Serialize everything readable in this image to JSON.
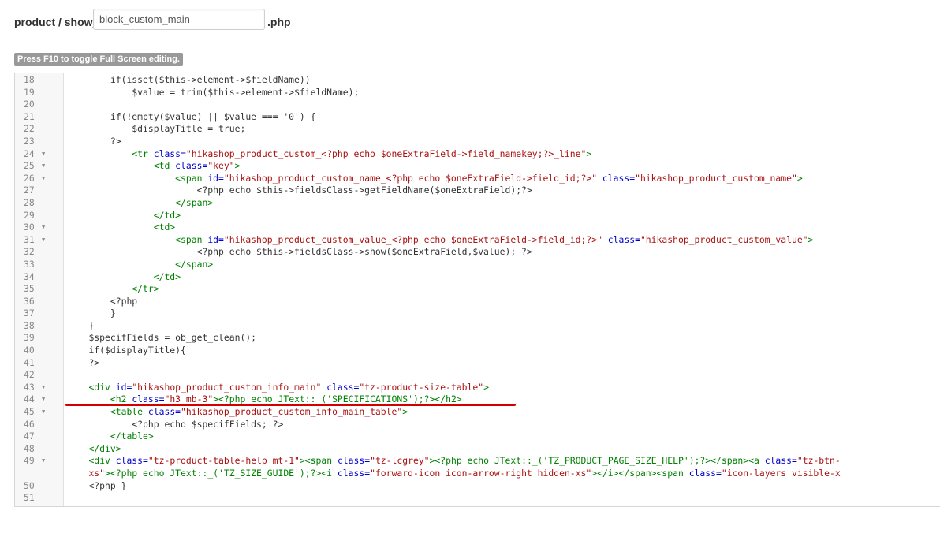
{
  "header": {
    "path_label": "product / show_",
    "file_input_value": "block_custom_main",
    "extension_label": ".php"
  },
  "hint": "Press F10 to toggle Full Screen editing.",
  "editor": {
    "lines": [
      {
        "num": "18",
        "fold": false,
        "indent": 8,
        "tokens": [
          {
            "t": "if(isset($this->element->$fieldName))",
            "c": "plain"
          }
        ]
      },
      {
        "num": "19",
        "fold": false,
        "indent": 12,
        "tokens": [
          {
            "t": "$value = trim($this->element->$fieldName);",
            "c": "plain"
          }
        ]
      },
      {
        "num": "20",
        "fold": false,
        "indent": 0,
        "tokens": []
      },
      {
        "num": "21",
        "fold": false,
        "indent": 8,
        "tokens": [
          {
            "t": "if(!empty($value) || $value === '0') {",
            "c": "plain"
          }
        ]
      },
      {
        "num": "22",
        "fold": false,
        "indent": 12,
        "tokens": [
          {
            "t": "$displayTitle = true;",
            "c": "plain"
          }
        ]
      },
      {
        "num": "23",
        "fold": false,
        "indent": 8,
        "tokens": [
          {
            "t": "?>",
            "c": "plain"
          }
        ]
      },
      {
        "num": "24",
        "fold": true,
        "indent": 12,
        "tokens": [
          {
            "t": "<tr ",
            "c": "tag"
          },
          {
            "t": "class=",
            "c": "attr"
          },
          {
            "t": "\"hikashop_product_custom_<?php echo $oneExtraField->field_namekey;?>_line\"",
            "c": "str"
          },
          {
            "t": ">",
            "c": "tag"
          }
        ]
      },
      {
        "num": "25",
        "fold": true,
        "indent": 16,
        "tokens": [
          {
            "t": "<td ",
            "c": "tag"
          },
          {
            "t": "class=",
            "c": "attr"
          },
          {
            "t": "\"key\"",
            "c": "str"
          },
          {
            "t": ">",
            "c": "tag"
          }
        ]
      },
      {
        "num": "26",
        "fold": true,
        "indent": 20,
        "tokens": [
          {
            "t": "<span ",
            "c": "tag"
          },
          {
            "t": "id=",
            "c": "attr"
          },
          {
            "t": "\"hikashop_product_custom_name_<?php echo $oneExtraField->field_id;?>\"",
            "c": "str"
          },
          {
            "t": " class=",
            "c": "attr"
          },
          {
            "t": "\"hikashop_product_custom_name\"",
            "c": "str"
          },
          {
            "t": ">",
            "c": "tag"
          }
        ]
      },
      {
        "num": "27",
        "fold": false,
        "indent": 24,
        "tokens": [
          {
            "t": "<?php echo $this->fieldsClass->getFieldName($oneExtraField);?>",
            "c": "plain"
          }
        ]
      },
      {
        "num": "28",
        "fold": false,
        "indent": 20,
        "tokens": [
          {
            "t": "</span>",
            "c": "tag"
          }
        ]
      },
      {
        "num": "29",
        "fold": false,
        "indent": 16,
        "tokens": [
          {
            "t": "</td>",
            "c": "tag"
          }
        ]
      },
      {
        "num": "30",
        "fold": true,
        "indent": 16,
        "tokens": [
          {
            "t": "<td>",
            "c": "tag"
          }
        ]
      },
      {
        "num": "31",
        "fold": true,
        "indent": 20,
        "tokens": [
          {
            "t": "<span ",
            "c": "tag"
          },
          {
            "t": "id=",
            "c": "attr"
          },
          {
            "t": "\"hikashop_product_custom_value_<?php echo $oneExtraField->field_id;?>\"",
            "c": "str"
          },
          {
            "t": " class=",
            "c": "attr"
          },
          {
            "t": "\"hikashop_product_custom_value\"",
            "c": "str"
          },
          {
            "t": ">",
            "c": "tag"
          }
        ]
      },
      {
        "num": "32",
        "fold": false,
        "indent": 24,
        "tokens": [
          {
            "t": "<?php echo $this->fieldsClass->show($oneExtraField,$value); ?>",
            "c": "plain"
          }
        ]
      },
      {
        "num": "33",
        "fold": false,
        "indent": 20,
        "tokens": [
          {
            "t": "</span>",
            "c": "tag"
          }
        ]
      },
      {
        "num": "34",
        "fold": false,
        "indent": 16,
        "tokens": [
          {
            "t": "</td>",
            "c": "tag"
          }
        ]
      },
      {
        "num": "35",
        "fold": false,
        "indent": 12,
        "tokens": [
          {
            "t": "</tr>",
            "c": "tag"
          }
        ]
      },
      {
        "num": "36",
        "fold": false,
        "indent": 8,
        "tokens": [
          {
            "t": "<?php",
            "c": "plain"
          }
        ]
      },
      {
        "num": "37",
        "fold": false,
        "indent": 8,
        "tokens": [
          {
            "t": "}",
            "c": "plain"
          }
        ]
      },
      {
        "num": "38",
        "fold": false,
        "indent": 4,
        "tokens": [
          {
            "t": "}",
            "c": "plain"
          }
        ]
      },
      {
        "num": "39",
        "fold": false,
        "indent": 4,
        "tokens": [
          {
            "t": "$specifFields = ob_get_clean();",
            "c": "plain"
          }
        ]
      },
      {
        "num": "40",
        "fold": false,
        "indent": 4,
        "tokens": [
          {
            "t": "if($displayTitle){",
            "c": "plain"
          }
        ]
      },
      {
        "num": "41",
        "fold": false,
        "indent": 4,
        "tokens": [
          {
            "t": "?>",
            "c": "plain"
          }
        ]
      },
      {
        "num": "42",
        "fold": false,
        "indent": 0,
        "tokens": []
      },
      {
        "num": "43",
        "fold": true,
        "indent": 4,
        "tokens": [
          {
            "t": "<div ",
            "c": "tag"
          },
          {
            "t": "id=",
            "c": "attr"
          },
          {
            "t": "\"hikashop_product_custom_info_main\"",
            "c": "str"
          },
          {
            "t": " class=",
            "c": "attr"
          },
          {
            "t": "\"tz-product-size-table\"",
            "c": "str"
          },
          {
            "t": ">",
            "c": "tag"
          }
        ]
      },
      {
        "num": "44",
        "fold": true,
        "indent": 8,
        "tokens": [
          {
            "t": "<h2 ",
            "c": "tag"
          },
          {
            "t": "class=",
            "c": "attr"
          },
          {
            "t": "\"h3 mb-3\"",
            "c": "str"
          },
          {
            "t": "><?php echo JText:: ('SPECIFICATIONS');?></h2>",
            "c": "tag"
          }
        ]
      },
      {
        "num": "45",
        "fold": true,
        "indent": 8,
        "tokens": [
          {
            "t": "<table ",
            "c": "tag"
          },
          {
            "t": "class=",
            "c": "attr"
          },
          {
            "t": "\"hikashop_product_custom_info_main_table\"",
            "c": "str"
          },
          {
            "t": ">",
            "c": "tag"
          }
        ]
      },
      {
        "num": "46",
        "fold": false,
        "indent": 12,
        "tokens": [
          {
            "t": "<?php echo $specifFields; ?>",
            "c": "plain"
          }
        ]
      },
      {
        "num": "47",
        "fold": false,
        "indent": 8,
        "tokens": [
          {
            "t": "</table>",
            "c": "tag"
          }
        ]
      },
      {
        "num": "48",
        "fold": false,
        "indent": 4,
        "tokens": [
          {
            "t": "</div>",
            "c": "tag"
          }
        ]
      },
      {
        "num": "49",
        "fold": true,
        "indent": 4,
        "tokens": [
          {
            "t": "<div ",
            "c": "tag"
          },
          {
            "t": "class=",
            "c": "attr"
          },
          {
            "t": "\"tz-product-table-help mt-1\"",
            "c": "str"
          },
          {
            "t": "><span ",
            "c": "tag"
          },
          {
            "t": "class=",
            "c": "attr"
          },
          {
            "t": "\"tz-lcgrey\"",
            "c": "str"
          },
          {
            "t": "><?php echo JText::_('TZ_PRODUCT_PAGE_SIZE_HELP');?></span><a ",
            "c": "tag"
          },
          {
            "t": "class=",
            "c": "attr"
          },
          {
            "t": "\"tz-btn-",
            "c": "str"
          }
        ]
      },
      {
        "num": "",
        "fold": false,
        "indent": 4,
        "tokens": [
          {
            "t": "xs\"",
            "c": "str"
          },
          {
            "t": "><?php echo JText::_('TZ_SIZE_GUIDE');?><i ",
            "c": "tag"
          },
          {
            "t": "class=",
            "c": "attr"
          },
          {
            "t": "\"forward-icon icon-arrow-right hidden-xs\"",
            "c": "str"
          },
          {
            "t": "></i></span><span ",
            "c": "tag"
          },
          {
            "t": "class=",
            "c": "attr"
          },
          {
            "t": "\"icon-layers visible-x",
            "c": "str"
          }
        ]
      },
      {
        "num": "50",
        "fold": false,
        "indent": 4,
        "tokens": [
          {
            "t": "<?php }",
            "c": "plain"
          }
        ]
      },
      {
        "num": "51",
        "fold": false,
        "indent": 0,
        "tokens": []
      }
    ]
  },
  "colors": {
    "tag": "#008000",
    "attr": "#0000cc",
    "string": "#aa1111",
    "annotation_underline": "#d40000"
  }
}
